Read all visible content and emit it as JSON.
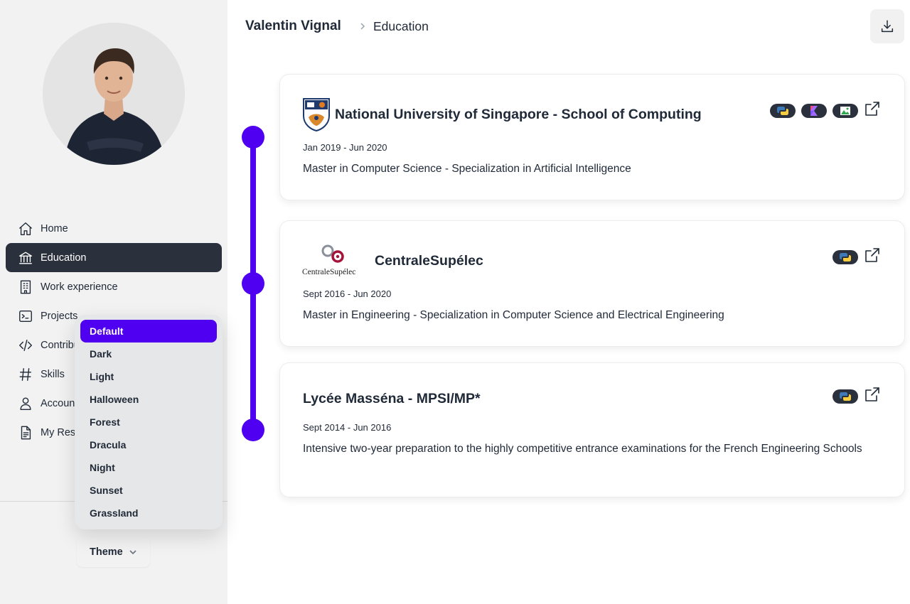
{
  "header": {
    "name": "Valentin Vignal",
    "page": "Education"
  },
  "sidebar": {
    "items": [
      {
        "label": "Home",
        "icon": "home-icon"
      },
      {
        "label": "Education",
        "icon": "bank-icon"
      },
      {
        "label": "Work experience",
        "icon": "building-icon"
      },
      {
        "label": "Projects",
        "icon": "terminal-icon"
      },
      {
        "label": "Contributions",
        "icon": "code-icon"
      },
      {
        "label": "Skills",
        "icon": "hashtag-icon"
      },
      {
        "label": "Accounts",
        "icon": "user-icon"
      },
      {
        "label": "My Resume",
        "icon": "document-icon"
      }
    ],
    "active": "Education"
  },
  "theme": {
    "button_label": "Theme",
    "selected": "Default",
    "options": [
      "Default",
      "Dark",
      "Light",
      "Halloween",
      "Forest",
      "Dracula",
      "Night",
      "Sunset",
      "Grassland"
    ]
  },
  "education": [
    {
      "school": "National University of Singapore - School of Computing",
      "dates": "Jan 2019 - Jun 2020",
      "description": "Master in Computer Science - Specialization in Artificial Intelligence",
      "tags": [
        "python-icon",
        "kotlin-icon",
        "android-icon"
      ]
    },
    {
      "school": "CentraleSupélec",
      "logo_text": "CentraleSupélec",
      "dates": "Sept 2016 - Jun 2020",
      "description": "Master in Engineering - Specialization in Computer Science and Electrical Engineering",
      "tags": [
        "python-icon"
      ]
    },
    {
      "school": "Lycée Masséna - MPSI/MP*",
      "dates": "Sept 2014 - Jun 2016",
      "description": "Intensive two-year preparation to the highly competitive entrance examinations for the French Engineering Schools",
      "tags": [
        "python-icon"
      ]
    }
  ],
  "colors": {
    "accent": "#4f00f0",
    "active_nav": "#2a303c",
    "sidebar_bg": "#f2f2f2"
  }
}
